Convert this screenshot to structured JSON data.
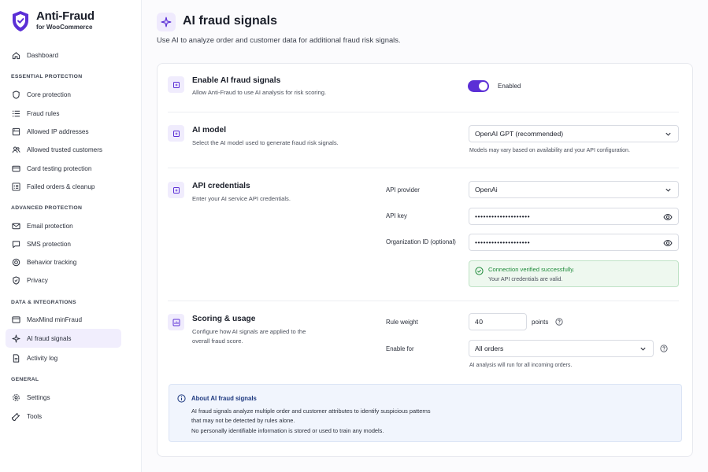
{
  "brand": {
    "title": "Anti-Fraud",
    "subtitle": "for WooCommerce"
  },
  "sidebar": {
    "dashboard": "Dashboard",
    "sections": {
      "essential": "ESSENTIAL PROTECTION",
      "advanced": "ADVANCED PROTECTION",
      "data": "DATA & INTEGRATIONS",
      "general": "GENERAL"
    },
    "items": [
      {
        "label": "Core protection",
        "icon": "shield-icon"
      },
      {
        "label": "Fraud rules",
        "icon": "list-icon"
      },
      {
        "label": "Allowed IP addresses",
        "icon": "server-icon"
      },
      {
        "label": "Allowed trusted customers",
        "icon": "users-icon"
      },
      {
        "label": "Card testing protection",
        "icon": "card-icon"
      },
      {
        "label": "Failed orders & cleanup",
        "icon": "checklist-icon"
      },
      {
        "label": "Email protection",
        "icon": "mail-icon"
      },
      {
        "label": "SMS protection",
        "icon": "sms-icon"
      },
      {
        "label": "Behavior tracking",
        "icon": "target-icon"
      },
      {
        "label": "Privacy",
        "icon": "privacy-shield-icon"
      },
      {
        "label": "MaxMind minFraud",
        "icon": "folder-icon"
      },
      {
        "label": "AI fraud signals",
        "icon": "sparkle-icon",
        "active": true
      },
      {
        "label": "Activity log",
        "icon": "document-icon"
      },
      {
        "label": "Settings",
        "icon": "gear-icon"
      },
      {
        "label": "Tools",
        "icon": "wrench-icon"
      }
    ]
  },
  "page": {
    "title": "AI fraud signals",
    "subtitle": "Use AI to analyze order and customer data for additional fraud risk signals."
  },
  "enable": {
    "title": "Enable AI fraud signals",
    "desc": "Allow Anti-Fraud to use AI analysis for risk scoring.",
    "toggle_label": "Enabled",
    "on": true
  },
  "model": {
    "title": "AI model",
    "desc": "Select the AI model used to generate fraud risk signals.",
    "selected": "OpenAI GPT (recommended)",
    "hint": "Models may vary based on availability and your API configuration."
  },
  "credentials": {
    "title": "API credentials",
    "desc": "Enter your AI service API credentials.",
    "provider_label": "API provider",
    "provider_value": "OpenAi",
    "key_label": "API key",
    "key_value": "••••••••••••••••••••",
    "org_label": "Organization ID (optional)",
    "org_value": "••••••••••••••••••••",
    "success_title": "Connection verified successfully.",
    "success_desc": "Your API credentials are valid."
  },
  "scoring": {
    "title": "Scoring & usage",
    "desc_line1": "Configure how AI signals are applied to the",
    "desc_line2": "overall fraud score.",
    "weight_label": "Rule weight",
    "weight_value": "40",
    "points_label": "points",
    "enable_for_label": "Enable for",
    "enable_for_value": "All orders",
    "enable_for_hint": "AI analysis will run for all incoming orders."
  },
  "info": {
    "title": "About AI fraud signals",
    "line1": "AI fraud signals analyze multiple order and customer attributes to identify suspicious patterns",
    "line2": "that may not be detected by rules alone.",
    "line3": "No personally identifiable information is stored or used to train any models."
  },
  "colors": {
    "accent": "#5b2fd6",
    "success": "#1e8a3a",
    "info_title": "#1f3a80"
  }
}
